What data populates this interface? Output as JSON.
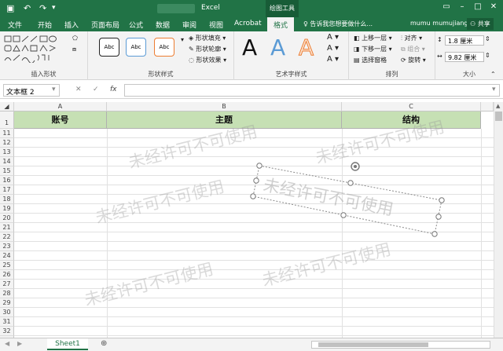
{
  "titlebar": {
    "app_title": "Excel",
    "context_tab": "绘图工具",
    "save_icon": "save-icon",
    "undo_icon": "undo-icon",
    "redo_icon": "redo-icon"
  },
  "tabs": [
    {
      "label": "文件"
    },
    {
      "label": "开始"
    },
    {
      "label": "插入"
    },
    {
      "label": "页面布局"
    },
    {
      "label": "公式"
    },
    {
      "label": "数据"
    },
    {
      "label": "审阅"
    },
    {
      "label": "视图"
    },
    {
      "label": "Acrobat"
    },
    {
      "label": "格式"
    }
  ],
  "tell_me": "告诉我您想要做什么...",
  "user_name": "mumu mumujiang",
  "share_label": "共享",
  "ribbon": {
    "insert_shapes_label": "插入形状",
    "shape_styles_label": "形状样式",
    "style_sample": "Abc",
    "shape_fill": "形状填充",
    "shape_outline": "形状轮廓",
    "shape_effects": "形状效果",
    "wordart_label": "艺术字样式",
    "wordart_sample": "A",
    "arrange_label": "排列",
    "bring_forward": "上移一层",
    "send_backward": "下移一层",
    "selection_pane": "选择窗格",
    "align": "对齐",
    "group": "组合",
    "rotate": "旋转",
    "size_label": "大小",
    "height_value": "1.8 厘米",
    "width_value": "9.82 厘米"
  },
  "formula_bar": {
    "name_box": "文本框 2",
    "fx": "fx",
    "cancel": "✕",
    "confirm": "✓"
  },
  "columns": [
    "A",
    "B",
    "C"
  ],
  "header_row": [
    "账号",
    "主题",
    "结构"
  ],
  "rows": [
    "1",
    "11",
    "12",
    "13",
    "14",
    "15",
    "16",
    "17",
    "18",
    "19",
    "20",
    "21",
    "22",
    "23",
    "24",
    "25",
    "26",
    "27",
    "28",
    "29",
    "30",
    "31",
    "32",
    "33"
  ],
  "watermark": "未经许可不可使用",
  "sheet_tab": "Sheet1"
}
